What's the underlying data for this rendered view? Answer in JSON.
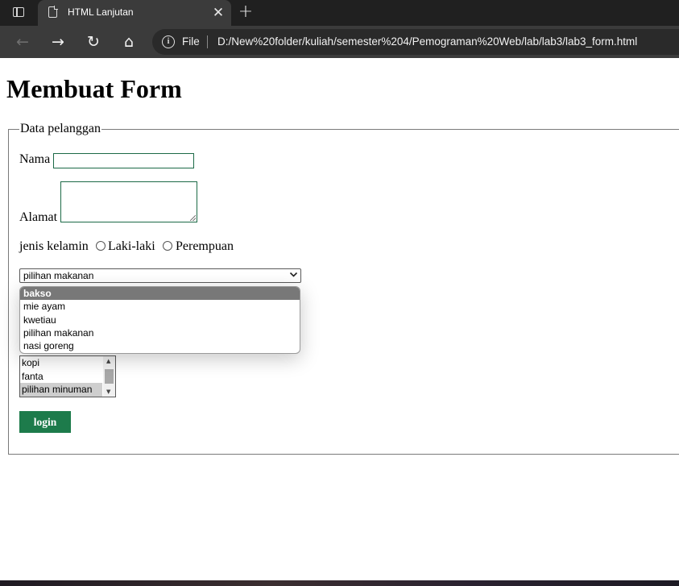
{
  "browser": {
    "tab_title": "HTML Lanjutan",
    "close_glyph": "✕",
    "new_tab_glyph": "+",
    "address_scheme_label": "File",
    "url": "D:/New%20folder/kuliah/semester%204/Pemograman%20Web/lab/lab3/lab3_form.html",
    "icons": {
      "back": "←",
      "forward": "→",
      "refresh": "↻",
      "home": "⌂",
      "info": "i"
    }
  },
  "page": {
    "title": "Membuat Form",
    "fieldset_legend": "Data pelanggan",
    "nama_label": "Nama",
    "nama_value": "",
    "alamat_label": "Alamat",
    "gender_label": "jenis kelamin",
    "gender_options": [
      "Laki-laki",
      "Perempuan"
    ],
    "food_select_value": "pilihan makanan",
    "food_options": [
      {
        "label": "bakso",
        "selected": true
      },
      {
        "label": "mie ayam",
        "selected": false
      },
      {
        "label": "kwetiau",
        "selected": false
      },
      {
        "label": "pilihan makanan",
        "selected": false
      },
      {
        "label": "nasi goreng",
        "selected": false
      }
    ],
    "drink_options": [
      {
        "label": "kopi",
        "selected": false
      },
      {
        "label": "fanta",
        "selected": false
      },
      {
        "label": "pilihan minuman",
        "selected": true
      }
    ],
    "login_label": "login"
  },
  "colors": {
    "button_green": "#1d7b4b",
    "input_border": "#1c6a47",
    "dropdown_highlight": "#787878"
  }
}
